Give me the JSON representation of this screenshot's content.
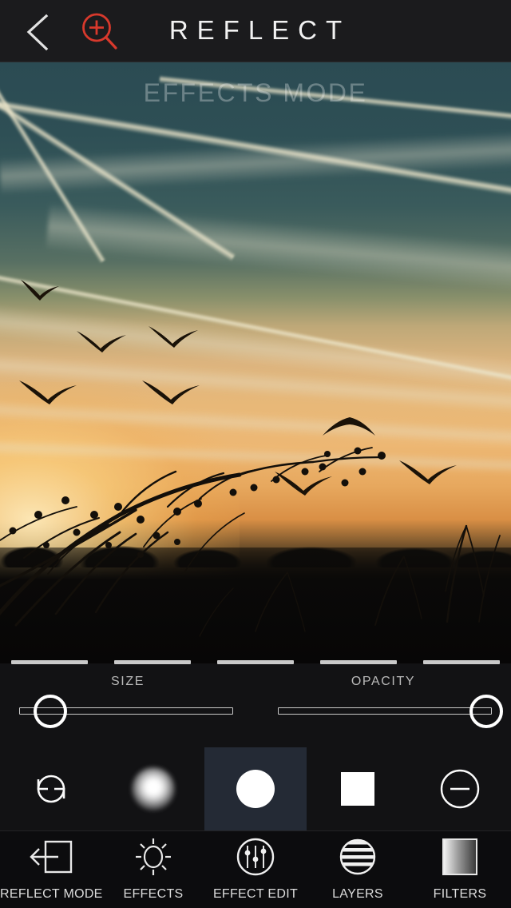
{
  "app": {
    "title": "REFLECT",
    "accent_red": "#d8392c",
    "panel_bg": "#121214",
    "selected_cell_bg": "#242a35"
  },
  "topbar": {
    "back_icon": "chevron-left-icon",
    "zoom_icon": "magnifier-plus-icon",
    "title": "REFLECT"
  },
  "canvas": {
    "overlay_label": "EFFECTS MODE",
    "photo_description": "Sunset sky with contrails, silhouetted birds and bare branches"
  },
  "sliders": [
    {
      "name": "size",
      "label": "SIZE",
      "value_percent": 0,
      "knob_position": "left"
    },
    {
      "name": "opacity",
      "label": "OPACITY",
      "value_percent": 100,
      "knob_position": "right"
    }
  ],
  "brushes": [
    {
      "id": "reset",
      "icon": "refresh-arrows-icon",
      "selected": false
    },
    {
      "id": "soft-round",
      "icon": "soft-round-brush-icon",
      "selected": false
    },
    {
      "id": "hard-round",
      "icon": "hard-round-brush-icon",
      "selected": true
    },
    {
      "id": "square",
      "icon": "square-brush-icon",
      "selected": false
    },
    {
      "id": "erase",
      "icon": "circle-minus-icon",
      "selected": false
    }
  ],
  "tabs": [
    {
      "id": "reflect-mode",
      "label": "REFLECT MODE",
      "icon": "arrow-into-box-icon",
      "active": false
    },
    {
      "id": "effects",
      "label": "EFFECTS",
      "icon": "sun-icon",
      "active": false
    },
    {
      "id": "effect-edit",
      "label": "EFFECT EDIT",
      "icon": "sliders-circle-icon",
      "active": true
    },
    {
      "id": "layers",
      "label": "LAYERS",
      "icon": "striped-circle-icon",
      "active": false
    },
    {
      "id": "filters",
      "label": "FILTERS",
      "icon": "gradient-square-icon",
      "active": false
    }
  ]
}
